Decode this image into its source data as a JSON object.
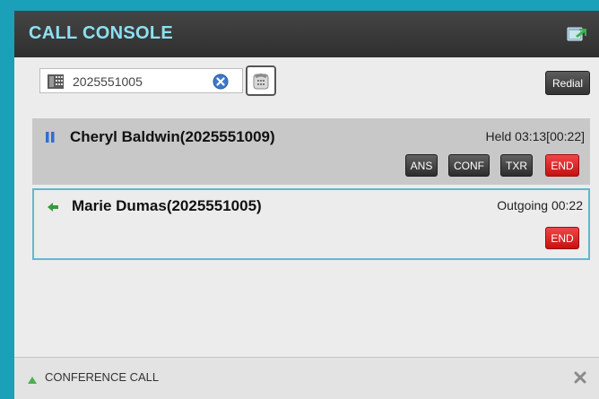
{
  "header": {
    "title": "CALL CONSOLE",
    "detach_icon": "detach-window-icon"
  },
  "toolbar": {
    "dial_value": "2025551005",
    "dialpad_icon": "dialpad-icon",
    "clear_icon": "clear-icon",
    "phone_icon": "phone-icon",
    "redial_label": "Redial"
  },
  "calls": [
    {
      "caller": "Cheryl Baldwin(2025551009)",
      "status": "Held 03:13[00:22]",
      "state_icon": "hold-icon",
      "buttons": [
        "ANS",
        "CONF",
        "TXR",
        "END"
      ]
    },
    {
      "caller": "Marie Dumas(2025551005)",
      "status": "Outgoing 00:22",
      "state_icon": "outgoing-arrow-icon",
      "buttons": [
        "END"
      ]
    }
  ],
  "footer": {
    "label": "CONFERENCE CALL",
    "expand_icon": "expand-triangle-icon",
    "close_icon": "close-icon"
  },
  "colors": {
    "frame": "#1aa0b8",
    "header_bg": "#3a3a3a",
    "title": "#8ee0f2",
    "held_row": "#c8c8c8",
    "active_border": "#5fb9cc",
    "end_button": "#d92020"
  }
}
